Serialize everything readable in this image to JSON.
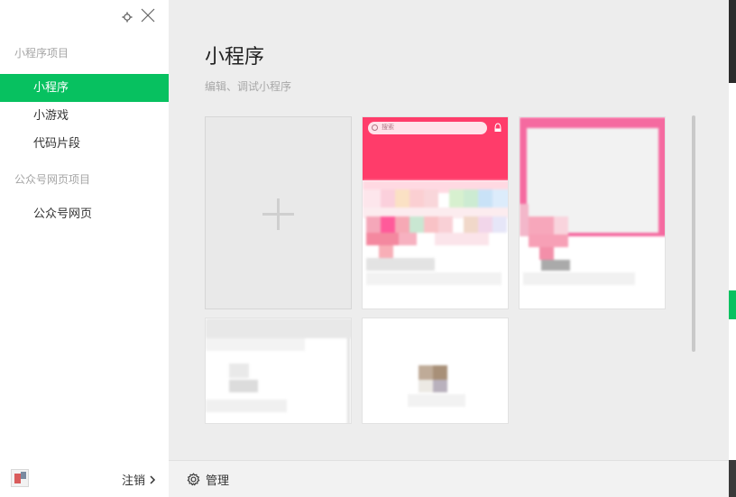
{
  "sidebar": {
    "sections": [
      {
        "title": "小程序项目",
        "items": [
          "小程序",
          "小游戏",
          "代码片段"
        ]
      },
      {
        "title": "公众号网页项目",
        "items": [
          "公众号网页"
        ]
      }
    ],
    "active_item": "小程序",
    "footer": {
      "logout_label": "注销"
    }
  },
  "main": {
    "title": "小程序",
    "subtitle": "编辑、调试小程序",
    "cards": [
      {
        "kind": "new-project"
      },
      {
        "kind": "project",
        "thumb_search_text": "搜索"
      },
      {
        "kind": "project"
      },
      {
        "kind": "project"
      },
      {
        "kind": "project"
      }
    ],
    "footer": {
      "manage_label": "管理"
    }
  },
  "colors": {
    "accent": "#07c160",
    "card_header": "#ff3c6a",
    "card_header_2": "#f56aa0"
  },
  "icons": {
    "settings": "gear-icon",
    "close": "close-icon",
    "add": "plus-icon",
    "manage": "gear-icon",
    "logout": "chevron-right-icon"
  }
}
